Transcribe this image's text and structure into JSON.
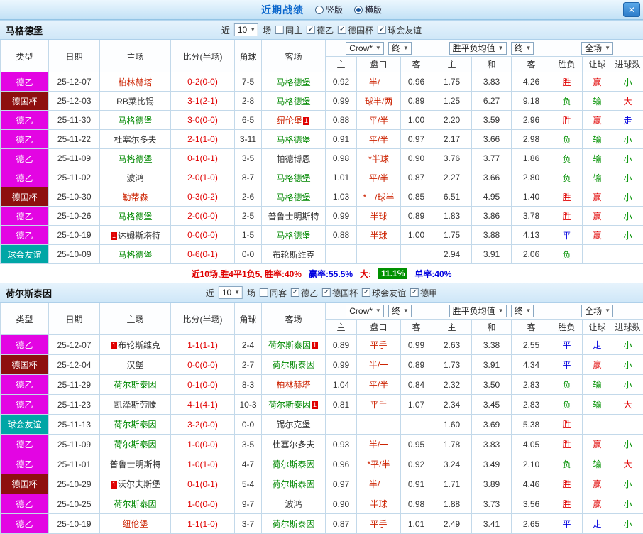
{
  "titlebar": {
    "title": "近期战绩",
    "radios": [
      {
        "label": "竖版",
        "selected": false
      },
      {
        "label": "横版",
        "selected": true
      }
    ],
    "close_label": "✕"
  },
  "columns": {
    "type": "类型",
    "date": "日期",
    "home": "主场",
    "score": "比分(半场)",
    "corner": "角球",
    "away": "客场",
    "odds_sub": [
      "主",
      "盘口",
      "客"
    ],
    "avg_sub": [
      "主",
      "和",
      "客"
    ],
    "result_sub": [
      "胜负",
      "让球",
      "进球数"
    ],
    "odds_select": "Crow*",
    "final_select": "终",
    "avg_select": "胜平负均值",
    "scope_select": "全场"
  },
  "type_colors": {
    "德乙": "#e305e3",
    "德国杯": "#8e0f0f",
    "球会友谊": "#00a6a6"
  },
  "result_colors": {
    "r": "#e00000",
    "g": "#009100",
    "b": "#0000dd"
  },
  "sections": [
    {
      "team": "马格德堡",
      "filter": {
        "prefix": "近",
        "count": "10",
        "suffix": "场",
        "checkboxes": [
          {
            "label": "同主",
            "checked": false
          },
          {
            "label": "德乙",
            "checked": true
          },
          {
            "label": "德国杯",
            "checked": true
          },
          {
            "label": "球会友谊",
            "checked": true
          }
        ]
      },
      "rows": [
        {
          "type": "德乙",
          "date": "25-12-07",
          "home": {
            "name": "柏林赫塔",
            "color": "red"
          },
          "score": "0-2(0-0)",
          "corner": "7-5",
          "away": {
            "name": "马格德堡",
            "color": "green"
          },
          "odds": [
            "0.92",
            "半/一",
            "0.96"
          ],
          "avg": [
            "1.75",
            "3.83",
            "4.26"
          ],
          "results": [
            [
              "胜",
              "r"
            ],
            [
              "赢",
              "r"
            ],
            [
              "小",
              "g"
            ]
          ]
        },
        {
          "type": "德国杯",
          "date": "25-12-03",
          "home": {
            "name": "RB莱比锡",
            "color": "black"
          },
          "score": "3-1(2-1)",
          "corner": "2-8",
          "away": {
            "name": "马格德堡",
            "color": "green"
          },
          "odds": [
            "0.99",
            "球半/两",
            "0.89"
          ],
          "avg": [
            "1.25",
            "6.27",
            "9.18"
          ],
          "results": [
            [
              "负",
              "g"
            ],
            [
              "输",
              "g"
            ],
            [
              "大",
              "r"
            ]
          ]
        },
        {
          "type": "德乙",
          "date": "25-11-30",
          "home": {
            "name": "马格德堡",
            "color": "green"
          },
          "score": "3-0(0-0)",
          "corner": "6-5",
          "away": {
            "name": "纽伦堡",
            "color": "red",
            "badge": "1",
            "badge_pos": "post"
          },
          "odds": [
            "0.88",
            "平/半",
            "1.00"
          ],
          "avg": [
            "2.20",
            "3.59",
            "2.96"
          ],
          "results": [
            [
              "胜",
              "r"
            ],
            [
              "赢",
              "r"
            ],
            [
              "走",
              "b"
            ]
          ]
        },
        {
          "type": "德乙",
          "date": "25-11-22",
          "home": {
            "name": "杜塞尔多夫",
            "color": "black"
          },
          "score": "2-1(1-0)",
          "corner": "3-11",
          "away": {
            "name": "马格德堡",
            "color": "green"
          },
          "odds": [
            "0.91",
            "平/半",
            "0.97"
          ],
          "avg": [
            "2.17",
            "3.66",
            "2.98"
          ],
          "results": [
            [
              "负",
              "g"
            ],
            [
              "输",
              "g"
            ],
            [
              "小",
              "g"
            ]
          ]
        },
        {
          "type": "德乙",
          "date": "25-11-09",
          "home": {
            "name": "马格德堡",
            "color": "green"
          },
          "score": "0-1(0-1)",
          "corner": "3-5",
          "away": {
            "name": "帕德博恩",
            "color": "black"
          },
          "odds": [
            "0.98",
            "*半球",
            "0.90"
          ],
          "avg": [
            "3.76",
            "3.77",
            "1.86"
          ],
          "results": [
            [
              "负",
              "g"
            ],
            [
              "输",
              "g"
            ],
            [
              "小",
              "g"
            ]
          ]
        },
        {
          "type": "德乙",
          "date": "25-11-02",
          "home": {
            "name": "波鸿",
            "color": "black"
          },
          "score": "2-0(1-0)",
          "corner": "8-7",
          "away": {
            "name": "马格德堡",
            "color": "green"
          },
          "odds": [
            "1.01",
            "平/半",
            "0.87"
          ],
          "avg": [
            "2.27",
            "3.66",
            "2.80"
          ],
          "results": [
            [
              "负",
              "g"
            ],
            [
              "输",
              "g"
            ],
            [
              "小",
              "g"
            ]
          ]
        },
        {
          "type": "德国杯",
          "date": "25-10-30",
          "home": {
            "name": "勒蒂森",
            "color": "red"
          },
          "score": "0-3(0-2)",
          "corner": "2-6",
          "away": {
            "name": "马格德堡",
            "color": "green"
          },
          "odds": [
            "1.03",
            "*一/球半",
            "0.85"
          ],
          "avg": [
            "6.51",
            "4.95",
            "1.40"
          ],
          "results": [
            [
              "胜",
              "r"
            ],
            [
              "赢",
              "r"
            ],
            [
              "小",
              "g"
            ]
          ]
        },
        {
          "type": "德乙",
          "date": "25-10-26",
          "home": {
            "name": "马格德堡",
            "color": "green"
          },
          "score": "2-0(0-0)",
          "corner": "2-5",
          "away": {
            "name": "普鲁士明斯特",
            "color": "black"
          },
          "odds": [
            "0.99",
            "半球",
            "0.89"
          ],
          "avg": [
            "1.83",
            "3.86",
            "3.78"
          ],
          "results": [
            [
              "胜",
              "r"
            ],
            [
              "赢",
              "r"
            ],
            [
              "小",
              "g"
            ]
          ]
        },
        {
          "type": "德乙",
          "date": "25-10-19",
          "home": {
            "name": "达姆斯塔特",
            "color": "black",
            "badge": "1",
            "badge_pos": "pre"
          },
          "score": "0-0(0-0)",
          "corner": "1-5",
          "away": {
            "name": "马格德堡",
            "color": "green"
          },
          "odds": [
            "0.88",
            "半球",
            "1.00"
          ],
          "avg": [
            "1.75",
            "3.88",
            "4.13"
          ],
          "results": [
            [
              "平",
              "b"
            ],
            [
              "赢",
              "r"
            ],
            [
              "小",
              "g"
            ]
          ]
        },
        {
          "type": "球会友谊",
          "date": "25-10-09",
          "home": {
            "name": "马格德堡",
            "color": "green"
          },
          "score": "0-6(0-1)",
          "corner": "0-0",
          "away": {
            "name": "布轮斯维克",
            "color": "black"
          },
          "odds": [
            "",
            "",
            ""
          ],
          "avg": [
            "2.94",
            "3.91",
            "2.06"
          ],
          "results": [
            [
              "负",
              "g"
            ],
            [
              "",
              ""
            ],
            [
              "",
              ""
            ]
          ]
        }
      ],
      "summary": [
        {
          "text": "近10场,胜4平1负5, 胜率:40%",
          "style": "red"
        },
        {
          "text": "赢率:55.5%",
          "style": "blue"
        },
        {
          "text": "大:",
          "style": "red"
        },
        {
          "text": "11.1%",
          "style": "green-badge"
        },
        {
          "text": "单率:40%",
          "style": "blue"
        }
      ]
    },
    {
      "team": "荷尔斯泰因",
      "filter": {
        "prefix": "近",
        "count": "10",
        "suffix": "场",
        "checkboxes": [
          {
            "label": "同客",
            "checked": false
          },
          {
            "label": "德乙",
            "checked": true
          },
          {
            "label": "德国杯",
            "checked": true
          },
          {
            "label": "球会友谊",
            "checked": true
          },
          {
            "label": "德甲",
            "checked": true
          }
        ]
      },
      "rows": [
        {
          "type": "德乙",
          "date": "25-12-07",
          "home": {
            "name": "布轮斯维克",
            "color": "black",
            "badge": "1",
            "badge_pos": "pre"
          },
          "score": "1-1(1-1)",
          "corner": "2-4",
          "away": {
            "name": "荷尔斯泰因",
            "color": "green",
            "badge": "1",
            "badge_pos": "post"
          },
          "odds": [
            "0.89",
            "平手",
            "0.99"
          ],
          "avg": [
            "2.63",
            "3.38",
            "2.55"
          ],
          "results": [
            [
              "平",
              "b"
            ],
            [
              "走",
              "b"
            ],
            [
              "小",
              "g"
            ]
          ]
        },
        {
          "type": "德国杯",
          "date": "25-12-04",
          "home": {
            "name": "汉堡",
            "color": "black"
          },
          "score": "0-0(0-0)",
          "corner": "2-7",
          "away": {
            "name": "荷尔斯泰因",
            "color": "green"
          },
          "odds": [
            "0.99",
            "半/一",
            "0.89"
          ],
          "avg": [
            "1.73",
            "3.91",
            "4.34"
          ],
          "results": [
            [
              "平",
              "b"
            ],
            [
              "赢",
              "r"
            ],
            [
              "小",
              "g"
            ]
          ]
        },
        {
          "type": "德乙",
          "date": "25-11-29",
          "home": {
            "name": "荷尔斯泰因",
            "color": "green"
          },
          "score": "0-1(0-0)",
          "corner": "8-3",
          "away": {
            "name": "柏林赫塔",
            "color": "red"
          },
          "odds": [
            "1.04",
            "平/半",
            "0.84"
          ],
          "avg": [
            "2.32",
            "3.50",
            "2.83"
          ],
          "results": [
            [
              "负",
              "g"
            ],
            [
              "输",
              "g"
            ],
            [
              "小",
              "g"
            ]
          ]
        },
        {
          "type": "德乙",
          "date": "25-11-23",
          "home": {
            "name": "凯泽斯劳滕",
            "color": "black"
          },
          "score": "4-1(4-1)",
          "corner": "10-3",
          "away": {
            "name": "荷尔斯泰因",
            "color": "green",
            "badge": "1",
            "badge_pos": "post"
          },
          "odds": [
            "0.81",
            "平手",
            "1.07"
          ],
          "avg": [
            "2.34",
            "3.45",
            "2.83"
          ],
          "results": [
            [
              "负",
              "g"
            ],
            [
              "输",
              "g"
            ],
            [
              "大",
              "r"
            ]
          ]
        },
        {
          "type": "球会友谊",
          "date": "25-11-13",
          "home": {
            "name": "荷尔斯泰因",
            "color": "green"
          },
          "score": "3-2(0-0)",
          "corner": "0-0",
          "away": {
            "name": "锡尔克堡",
            "color": "black"
          },
          "odds": [
            "",
            "",
            ""
          ],
          "avg": [
            "1.60",
            "3.69",
            "5.38"
          ],
          "results": [
            [
              "胜",
              "r"
            ],
            [
              "",
              ""
            ],
            [
              "",
              ""
            ]
          ]
        },
        {
          "type": "德乙",
          "date": "25-11-09",
          "home": {
            "name": "荷尔斯泰因",
            "color": "green"
          },
          "score": "1-0(0-0)",
          "corner": "3-5",
          "away": {
            "name": "杜塞尔多夫",
            "color": "black"
          },
          "odds": [
            "0.93",
            "半/一",
            "0.95"
          ],
          "avg": [
            "1.78",
            "3.83",
            "4.05"
          ],
          "results": [
            [
              "胜",
              "r"
            ],
            [
              "赢",
              "r"
            ],
            [
              "小",
              "g"
            ]
          ]
        },
        {
          "type": "德乙",
          "date": "25-11-01",
          "home": {
            "name": "普鲁士明斯特",
            "color": "black"
          },
          "score": "1-0(1-0)",
          "corner": "4-7",
          "away": {
            "name": "荷尔斯泰因",
            "color": "green"
          },
          "odds": [
            "0.96",
            "*平/半",
            "0.92"
          ],
          "avg": [
            "3.24",
            "3.49",
            "2.10"
          ],
          "results": [
            [
              "负",
              "g"
            ],
            [
              "输",
              "g"
            ],
            [
              "大",
              "r"
            ]
          ]
        },
        {
          "type": "德国杯",
          "date": "25-10-29",
          "home": {
            "name": "沃尔夫斯堡",
            "color": "black",
            "badge": "1",
            "badge_pos": "pre"
          },
          "score": "0-1(0-1)",
          "corner": "5-4",
          "away": {
            "name": "荷尔斯泰因",
            "color": "green"
          },
          "odds": [
            "0.97",
            "半/一",
            "0.91"
          ],
          "avg": [
            "1.71",
            "3.89",
            "4.46"
          ],
          "results": [
            [
              "胜",
              "r"
            ],
            [
              "赢",
              "r"
            ],
            [
              "小",
              "g"
            ]
          ]
        },
        {
          "type": "德乙",
          "date": "25-10-25",
          "home": {
            "name": "荷尔斯泰因",
            "color": "green"
          },
          "score": "1-0(0-0)",
          "corner": "9-7",
          "away": {
            "name": "波鸿",
            "color": "black"
          },
          "odds": [
            "0.90",
            "半球",
            "0.98"
          ],
          "avg": [
            "1.88",
            "3.73",
            "3.56"
          ],
          "results": [
            [
              "胜",
              "r"
            ],
            [
              "赢",
              "r"
            ],
            [
              "小",
              "g"
            ]
          ]
        },
        {
          "type": "德乙",
          "date": "25-10-19",
          "home": {
            "name": "纽伦堡",
            "color": "red"
          },
          "score": "1-1(1-0)",
          "corner": "3-7",
          "away": {
            "name": "荷尔斯泰因",
            "color": "green"
          },
          "odds": [
            "0.87",
            "平手",
            "1.01"
          ],
          "avg": [
            "2.49",
            "3.41",
            "2.65"
          ],
          "results": [
            [
              "平",
              "b"
            ],
            [
              "走",
              "b"
            ],
            [
              "小",
              "g"
            ]
          ]
        }
      ],
      "summary": []
    }
  ]
}
